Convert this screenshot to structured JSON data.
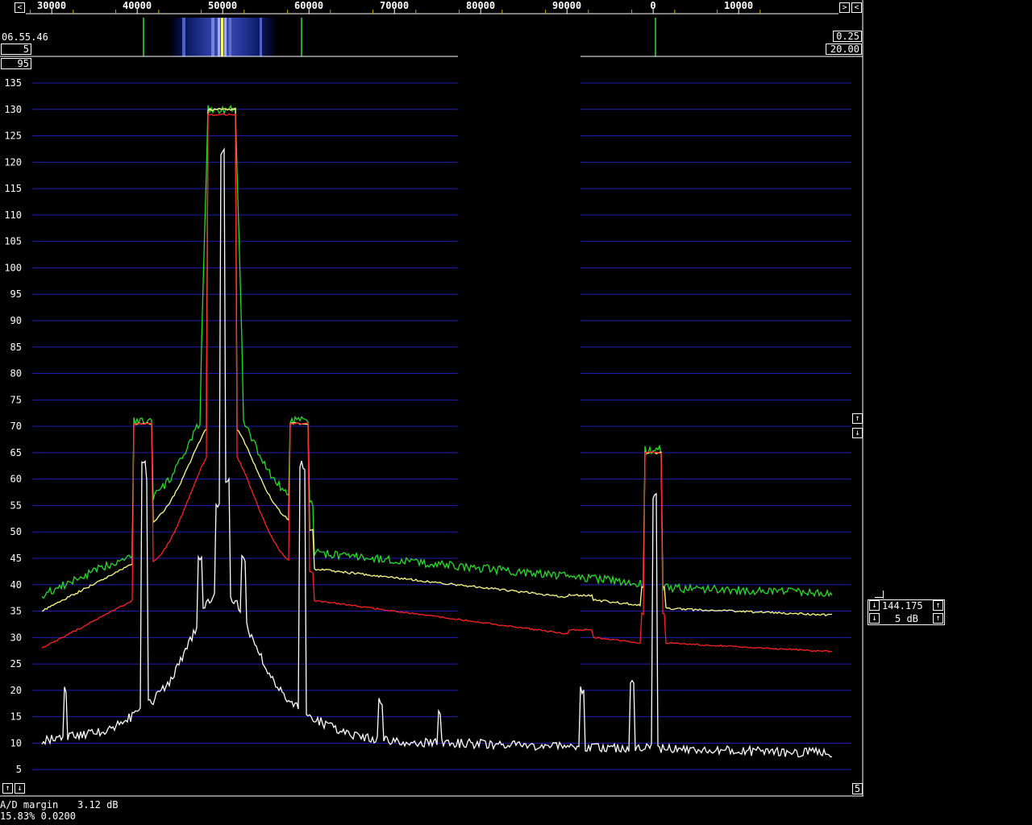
{
  "frequency_scale": {
    "labels": [
      "30000",
      "40000",
      "50000",
      "60000",
      "70000",
      "80000",
      "90000",
      "0",
      "10000"
    ]
  },
  "waterfall_panel": {
    "time": "06.55.46",
    "avg_value": "5",
    "waterfall_gain": "0.25",
    "waterfall_zero": "20.00",
    "spectrum_top": "95"
  },
  "spectrum": {
    "y_ticks": [
      "135",
      "130",
      "125",
      "120",
      "115",
      "110",
      "105",
      "100",
      "95",
      "90",
      "85",
      "80",
      "75",
      "70",
      "65",
      "60",
      "55",
      "50",
      "45",
      "40",
      "35",
      "30",
      "25",
      "20",
      "15",
      "10",
      "5"
    ],
    "bottom_right_value": "5"
  },
  "right_controls": {
    "zoom_value": "144.175",
    "db_per_div": "5 dB"
  },
  "status": {
    "ad_margin_label": "A/D margin",
    "ad_margin_value": "3.12 dB",
    "cpu_line": "15.83% 0.0200"
  },
  "icons": {
    "left": "arrow-left-icon",
    "right": "arrow-right-icon",
    "up": "arrow-up-icon",
    "down": "arrow-down-icon"
  },
  "colors": {
    "background": "#000000",
    "grid": "#1e1eb4",
    "frame": "#ffffff",
    "trace_max": "#22dd22",
    "trace_avg": "#ffff88",
    "trace_min": "#ff2020",
    "trace_instant": "#ffffff"
  },
  "chart_data": {
    "type": "line",
    "xlabel": "",
    "ylabel": "",
    "ylim": [
      0,
      137
    ],
    "x_ticks": [
      "30000",
      "40000",
      "50000",
      "60000",
      "70000",
      "80000",
      "90000",
      "0",
      "10000"
    ],
    "y_ticks": [
      5,
      10,
      15,
      20,
      25,
      30,
      35,
      40,
      45,
      50,
      55,
      60,
      65,
      70,
      75,
      80,
      85,
      90,
      95,
      100,
      105,
      110,
      115,
      120,
      125,
      130,
      135
    ]
  }
}
